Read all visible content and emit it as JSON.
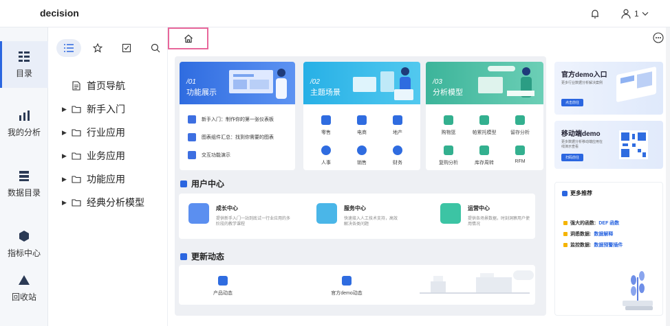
{
  "app": {
    "title": "decision"
  },
  "header": {
    "user_count": "1"
  },
  "rail": {
    "items": [
      {
        "label": "目录",
        "icon": "directory-icon"
      },
      {
        "label": "我的分析",
        "icon": "analysis-icon"
      },
      {
        "label": "数据目录",
        "icon": "data-catalog-icon"
      },
      {
        "label": "指标中心",
        "icon": "metrics-icon"
      },
      {
        "label": "回收站",
        "icon": "recycle-bin-icon"
      }
    ]
  },
  "directory": {
    "items": [
      {
        "label": "首页导航",
        "type": "file"
      },
      {
        "label": "新手入门",
        "type": "folder"
      },
      {
        "label": "行业应用",
        "type": "folder"
      },
      {
        "label": "业务应用",
        "type": "folder"
      },
      {
        "label": "功能应用",
        "type": "folder"
      },
      {
        "label": "经典分析模型",
        "type": "folder"
      }
    ]
  },
  "cards": [
    {
      "num": "/01",
      "title": "功能展示",
      "items": [
        {
          "label": "新手入门：制作你的第一张仪表板"
        },
        {
          "label": "图表组件汇总：找到你需要的图表"
        },
        {
          "label": "交互功能演示"
        }
      ]
    },
    {
      "num": "/02",
      "title": "主题场景",
      "items": [
        {
          "label": "零售"
        },
        {
          "label": "电商"
        },
        {
          "label": "地产"
        },
        {
          "label": "人事"
        },
        {
          "label": "销售"
        },
        {
          "label": "财务"
        }
      ]
    },
    {
      "num": "/03",
      "title": "分析模型",
      "items": [
        {
          "label": "购物篮"
        },
        {
          "label": "帕累托模型"
        },
        {
          "label": "留存分析"
        },
        {
          "label": "复购分析"
        },
        {
          "label": "库存周转"
        },
        {
          "label": "RFM"
        }
      ]
    }
  ],
  "user_center": {
    "title": "用户中心",
    "items": [
      {
        "title": "成长中心",
        "desc": "提供新手入门一站到底试一行业应用的多阶段的教学课程"
      },
      {
        "title": "服务中心",
        "desc": "快速接入人工技术支持，高效解决各类问题"
      },
      {
        "title": "运营中心",
        "desc": "提供各场景数据，时刻洞察用户使用情况"
      }
    ]
  },
  "updates": {
    "title": "更新动态",
    "items": [
      {
        "label": "产品动态"
      },
      {
        "label": "官方demo动态"
      }
    ]
  },
  "promos": [
    {
      "title": "官方demo入口",
      "desc": "更多行业数据分析解决案例",
      "button": "点击前往"
    },
    {
      "title": "移动端demo",
      "desc": "更多数据分析移动端应用在线演示查看",
      "button": "扫码前往"
    }
  ],
  "recommend": {
    "title": "更多推荐",
    "items": [
      {
        "key": "强大的函数:",
        "value": "DEF 函数"
      },
      {
        "key": "洞悉数据:",
        "value": "数据解释"
      },
      {
        "key": "监控数据:",
        "value": "数据预警插件"
      }
    ]
  },
  "colors": {
    "accent": "#2b66e0",
    "highlight_border": "#e8669a"
  }
}
